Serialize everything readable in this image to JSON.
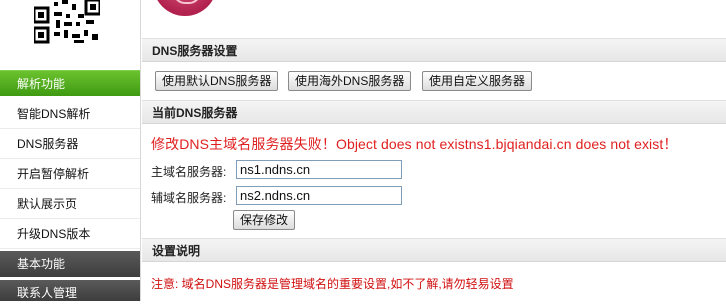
{
  "sidebar": {
    "section_main": "解析功能",
    "items": [
      {
        "label": "智能DNS解析"
      },
      {
        "label": "DNS服务器"
      },
      {
        "label": "开启暂停解析"
      },
      {
        "label": "默认展示页"
      },
      {
        "label": "升级DNS版本"
      }
    ],
    "section_basic": "基本功能",
    "section_contact": "联系人管理"
  },
  "dns_settings": {
    "title": "DNS服务器设置",
    "buttons": {
      "default": "使用默认DNS服务器",
      "overseas": "使用海外DNS服务器",
      "custom": "使用自定义服务器"
    }
  },
  "current": {
    "title": "当前DNS服务器",
    "error": "修改DNS主域名服务器失败！Object does not existns1.bjqiandai.cn does not exist！",
    "primary_label": "主域名服务器:",
    "primary_value": "ns1.ndns.cn",
    "secondary_label": "辅域名服务器:",
    "secondary_value": "ns2.ndns.cn",
    "save_label": "保存修改"
  },
  "notes": {
    "title": "设置说明",
    "text": "注意: 域名DNS服务器是管理域名的重要设置,如不了解,请勿轻易设置"
  },
  "colors": {
    "accent_green": "#4aa818",
    "error_red": "#e02020"
  }
}
